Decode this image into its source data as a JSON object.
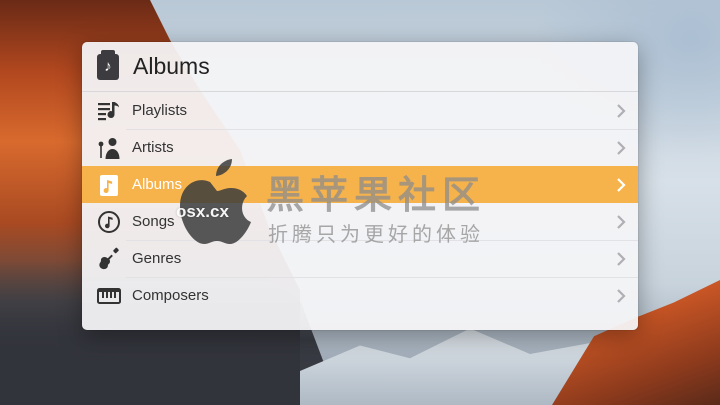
{
  "window": {
    "title": "Albums",
    "title_icon": "music-note-card-icon"
  },
  "menu": {
    "items": [
      {
        "label": "Playlists",
        "icon": "playlist-icon",
        "selected": false
      },
      {
        "label": "Artists",
        "icon": "artist-microphone-icon",
        "selected": false
      },
      {
        "label": "Albums",
        "icon": "album-music-note-icon",
        "selected": true
      },
      {
        "label": "Songs",
        "icon": "song-note-circle-icon",
        "selected": false
      },
      {
        "label": "Genres",
        "icon": "guitar-icon",
        "selected": false
      },
      {
        "label": "Composers",
        "icon": "piano-keyboard-icon",
        "selected": false
      }
    ]
  },
  "watermark": {
    "title": "黑苹果社区",
    "domain": "osx.cx",
    "subtitle": "折腾只为更好的体验"
  },
  "colors": {
    "selection": "#f7b34b",
    "text": "#333333",
    "chevron": "#b0b0b4"
  }
}
